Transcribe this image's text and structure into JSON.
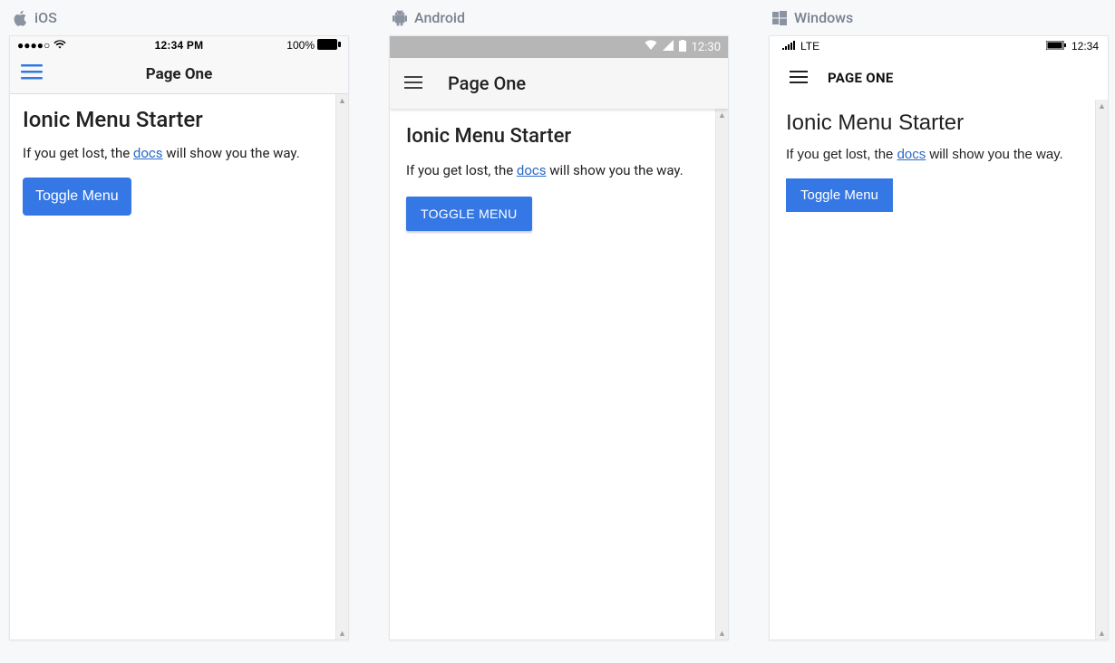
{
  "platforms": {
    "ios": {
      "label": "iOS"
    },
    "android": {
      "label": "Android"
    },
    "windows": {
      "label": "Windows"
    }
  },
  "ios": {
    "status": {
      "time": "12:34 PM",
      "battery_pct": "100%"
    },
    "nav": {
      "title": "Page One"
    },
    "content": {
      "heading": "Ionic Menu Starter",
      "text_before": "If you get lost, the ",
      "link_text": "docs",
      "text_after": " will show you the way.",
      "button": "Toggle Menu"
    }
  },
  "android": {
    "status": {
      "time": "12:30"
    },
    "nav": {
      "title": "Page One"
    },
    "content": {
      "heading": "Ionic Menu Starter",
      "text_before": "If you get lost, the ",
      "link_text": "docs",
      "text_after": " will show you the way.",
      "button": "TOGGLE MENU"
    }
  },
  "windows": {
    "status": {
      "carrier": "LTE",
      "time": "12:34"
    },
    "nav": {
      "title": "PAGE ONE"
    },
    "content": {
      "heading": "Ionic Menu Starter",
      "text_before": "If you get lost, the ",
      "link_text": "docs",
      "text_after": " will show you the way.",
      "button": "Toggle Menu"
    }
  }
}
